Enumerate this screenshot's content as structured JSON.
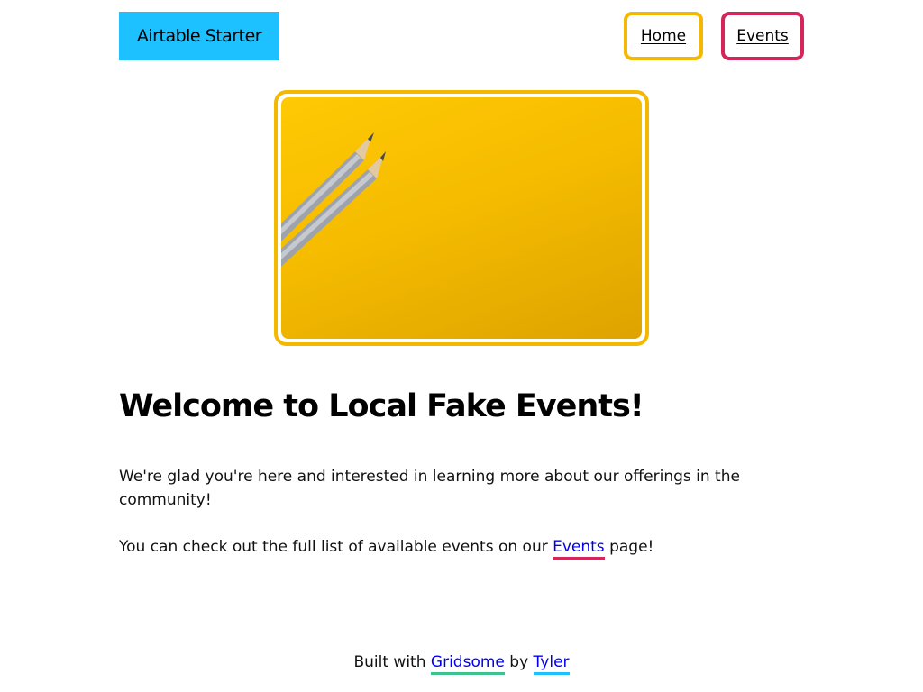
{
  "header": {
    "brand": "Airtable Starter",
    "nav": {
      "home": "Home",
      "events": "Events"
    }
  },
  "hero": {
    "image_alt": "Two pencils on a yellow background"
  },
  "main": {
    "title": "Welcome to Local Fake Events!",
    "intro": "We're glad you're here and interested in learning more about our offerings in the community!",
    "cta_prefix": "You can check out the full list of available events on our",
    "cta_link": "Events",
    "cta_suffix": "page!"
  },
  "footer": {
    "built_with": "Built with",
    "framework_link": "Gridsome",
    "by": "by",
    "author_link": "Tyler"
  },
  "colors": {
    "brand_bg": "#1ec1ff",
    "home_border": "#f5b800",
    "events_border": "#d5265b",
    "hero_border": "#f5b800",
    "link": "#0000ee",
    "gridsome_underline": "#3dc28f",
    "tyler_underline": "#1ec1ff"
  }
}
